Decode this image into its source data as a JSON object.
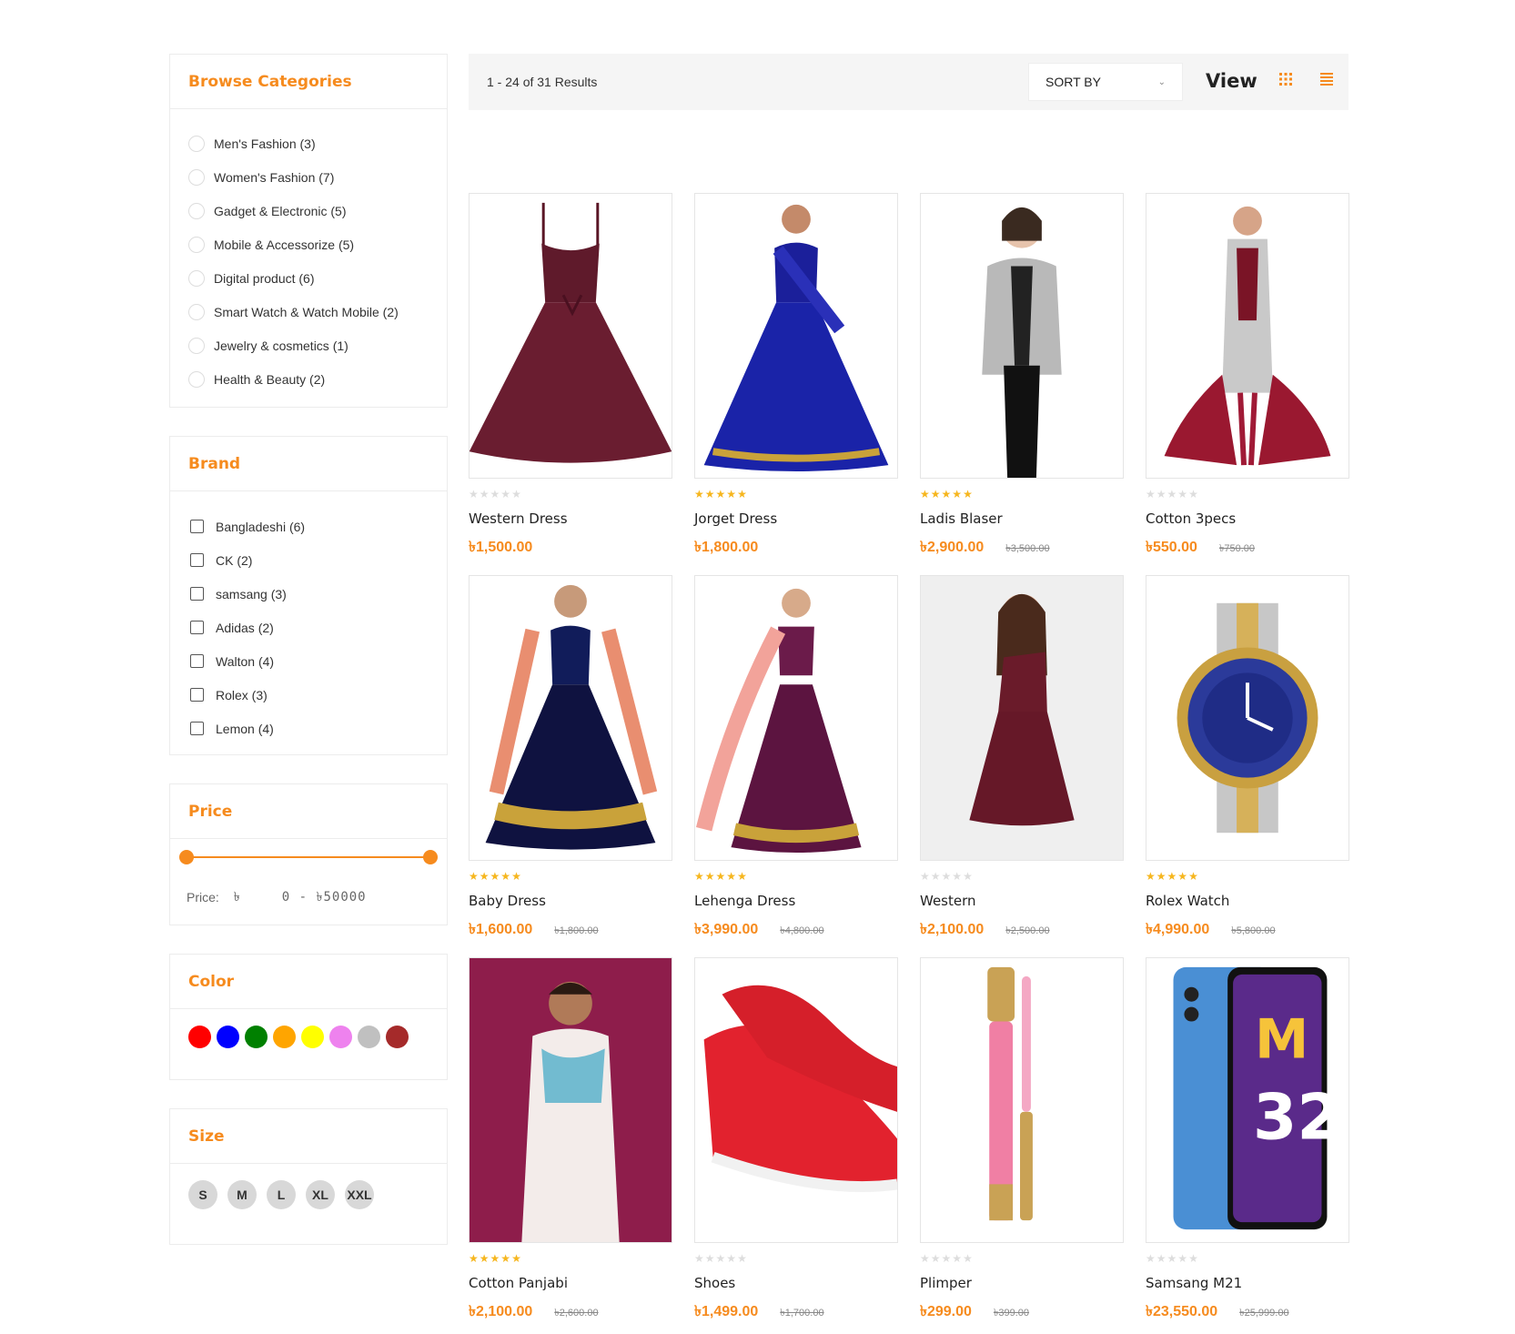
{
  "sidebar": {
    "categories": {
      "title": "Browse Categories",
      "items": [
        {
          "label": "Men's Fashion (3)"
        },
        {
          "label": "Women's Fashion (7)"
        },
        {
          "label": "Gadget & Electronic (5)"
        },
        {
          "label": "Mobile & Accessorize (5)"
        },
        {
          "label": "Digital product (6)"
        },
        {
          "label": "Smart Watch & Watch Mobile (2)"
        },
        {
          "label": "Jewelry & cosmetics (1)"
        },
        {
          "label": "Health & Beauty (2)"
        }
      ]
    },
    "brand": {
      "title": "Brand",
      "items": [
        {
          "label": "Bangladeshi (6)"
        },
        {
          "label": "CK (2)"
        },
        {
          "label": "samsang (3)"
        },
        {
          "label": "Adidas (2)"
        },
        {
          "label": "Walton (4)"
        },
        {
          "label": "Rolex (3)"
        },
        {
          "label": "Lemon (4)"
        }
      ]
    },
    "price": {
      "title": "Price",
      "label": "Price:",
      "currency": "৳",
      "range": "0 - ৳50000",
      "min_fraction": 0,
      "max_fraction": 1
    },
    "color": {
      "title": "Color",
      "swatches": [
        "#ff0000",
        "#0000ff",
        "#008000",
        "#ffa500",
        "#ffff00",
        "#ee82ee",
        "#c0c0c0",
        "#a52a2a"
      ]
    },
    "size": {
      "title": "Size",
      "items": [
        "S",
        "M",
        "L",
        "XL",
        "XXL"
      ]
    }
  },
  "toolbar": {
    "results": "1 - 24 of 31 Results",
    "sort_label": "SORT BY",
    "view_label": "View",
    "grid_icon": "grid-icon",
    "list_icon": "list-icon",
    "accent": "#f68b1e"
  },
  "products": [
    {
      "name": "Western Dress",
      "price": "৳1,500.00",
      "old_price": "",
      "rating": 0,
      "image": "maroon-dress"
    },
    {
      "name": "Jorget Dress",
      "price": "৳1,800.00",
      "old_price": "",
      "rating": 5,
      "image": "blue-lehenga"
    },
    {
      "name": "Ladis Blaser",
      "price": "৳2,900.00",
      "old_price": "৳3,500.00",
      "rating": 5,
      "image": "blazer"
    },
    {
      "name": "Cotton 3pecs",
      "price": "৳550.00",
      "old_price": "৳750.00",
      "rating": 0,
      "image": "salwar"
    },
    {
      "name": "Baby Dress",
      "price": "৳1,600.00",
      "old_price": "৳1,800.00",
      "rating": 5,
      "image": "baby-lehenga"
    },
    {
      "name": "Lehenga Dress",
      "price": "৳3,990.00",
      "old_price": "৳4,800.00",
      "rating": 5,
      "image": "lehenga"
    },
    {
      "name": "Western",
      "price": "৳2,100.00",
      "old_price": "৳2,500.00",
      "rating": 0,
      "image": "one-shoulder-dress"
    },
    {
      "name": "Rolex Watch",
      "price": "৳4,990.00",
      "old_price": "৳5,800.00",
      "rating": 5,
      "image": "watch"
    },
    {
      "name": "Cotton Panjabi",
      "price": "৳2,100.00",
      "old_price": "৳2,600.00",
      "rating": 5,
      "image": "panjabi"
    },
    {
      "name": "Shoes",
      "price": "৳1,499.00",
      "old_price": "৳1,700.00",
      "rating": 0,
      "image": "shoes"
    },
    {
      "name": "Plimper",
      "price": "৳299.00",
      "old_price": "৳399.00",
      "rating": 0,
      "image": "lip-gloss"
    },
    {
      "name": "Samsang M21",
      "price": "৳23,550.00",
      "old_price": "৳25,999.00",
      "rating": 0,
      "image": "phone"
    }
  ]
}
